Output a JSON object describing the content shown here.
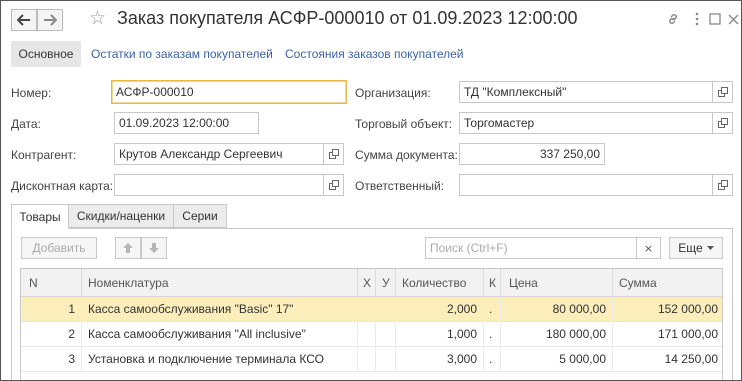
{
  "window": {
    "title": "Заказ покупателя АСФР-000010 от 01.09.2023 12:00:00"
  },
  "icons": {
    "back": "arrow-left-icon",
    "forward": "arrow-right-icon",
    "favorite": "star-icon",
    "link": "link-icon",
    "menu": "more-vertical-icon",
    "maximize": "maximize-icon",
    "close": "close-icon",
    "open": "open-form-icon",
    "clear": "clear-x-icon"
  },
  "nav": {
    "main": "Основное",
    "links": [
      "Остатки по заказам покупателей",
      "Состояния заказов покупателей"
    ]
  },
  "form": {
    "number_label": "Номер:",
    "number_value": "АСФР-000010",
    "date_label": "Дата:",
    "date_value": "01.09.2023 12:00:00",
    "counterparty_label": "Контрагент:",
    "counterparty_value": "Крутов Александр Сергеевич",
    "discount_card_label": "Дисконтная карта:",
    "discount_card_value": "",
    "organization_label": "Организация:",
    "organization_value": "ТД \"Комплексный\"",
    "trade_object_label": "Торговый объект:",
    "trade_object_value": "Торгомастер",
    "doc_sum_label": "Сумма документа:",
    "doc_sum_value": "337 250,00",
    "responsible_label": "Ответственный:",
    "responsible_value": ""
  },
  "tabs": [
    "Товары",
    "Скидки/наценки",
    "Серии"
  ],
  "toolbar": {
    "add_label": "Добавить",
    "up_icon": "arrow-up-icon",
    "down_icon": "arrow-down-icon",
    "search_placeholder": "Поиск (Ctrl+F)",
    "clear_label": "×",
    "more_label": "Еще"
  },
  "table": {
    "columns": [
      "N",
      "Номенклатура",
      "Х",
      "У",
      "Количество",
      "К",
      "Цена",
      "Сумма"
    ],
    "rows": [
      {
        "n": "1",
        "name": "Касса самообслуживания \"Basic\" 17\"",
        "x": "",
        "y": "",
        "qty": "2,000",
        "k": ".",
        "price": "80 000,00",
        "sum": "152 000,00"
      },
      {
        "n": "2",
        "name": "Касса самообслуживания \"All inclusive\"",
        "x": "",
        "y": "",
        "qty": "1,000",
        "k": ".",
        "price": "180 000,00",
        "sum": "171 000,00"
      },
      {
        "n": "3",
        "name": "Установка и подключение терминала КСО",
        "x": "",
        "y": "",
        "qty": "3,000",
        "k": ".",
        "price": "5 000,00",
        "sum": "14 250,00"
      }
    ]
  }
}
